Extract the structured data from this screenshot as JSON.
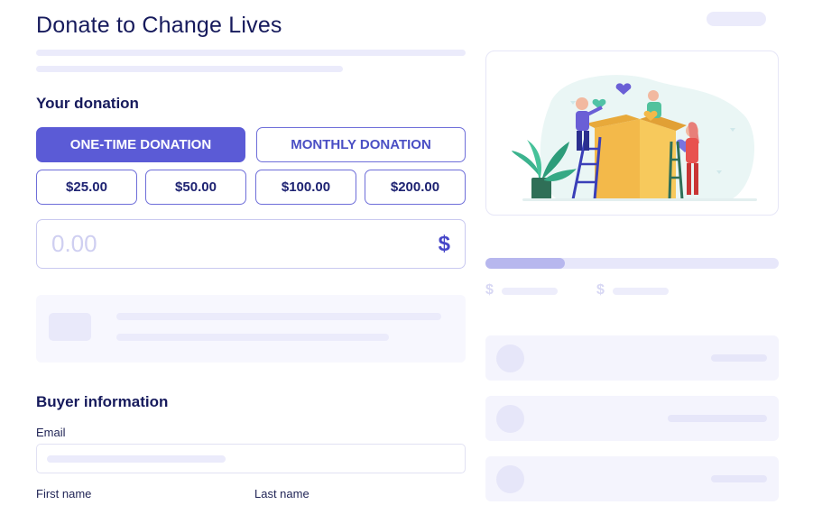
{
  "header": {
    "title": "Donate to Change Lives"
  },
  "donation": {
    "section_title": "Your donation",
    "frequency_tabs": [
      {
        "label": "ONE-TIME DONATION",
        "active": true
      },
      {
        "label": "MONTHLY DONATION",
        "active": false
      }
    ],
    "amount_options": [
      "$25.00",
      "$50.00",
      "$100.00",
      "$200.00"
    ],
    "custom_amount": {
      "placeholder": "0.00",
      "currency_symbol": "$"
    }
  },
  "buyer": {
    "section_title": "Buyer information",
    "email_label": "Email",
    "first_name_label": "First name",
    "last_name_label": "Last name"
  },
  "sidebar": {
    "progress": 0.27,
    "stat_symbols": [
      "$",
      "$"
    ]
  },
  "colors": {
    "accent": "#5b5bd6",
    "title": "#161a5c",
    "skeleton": "#ebebfb"
  }
}
